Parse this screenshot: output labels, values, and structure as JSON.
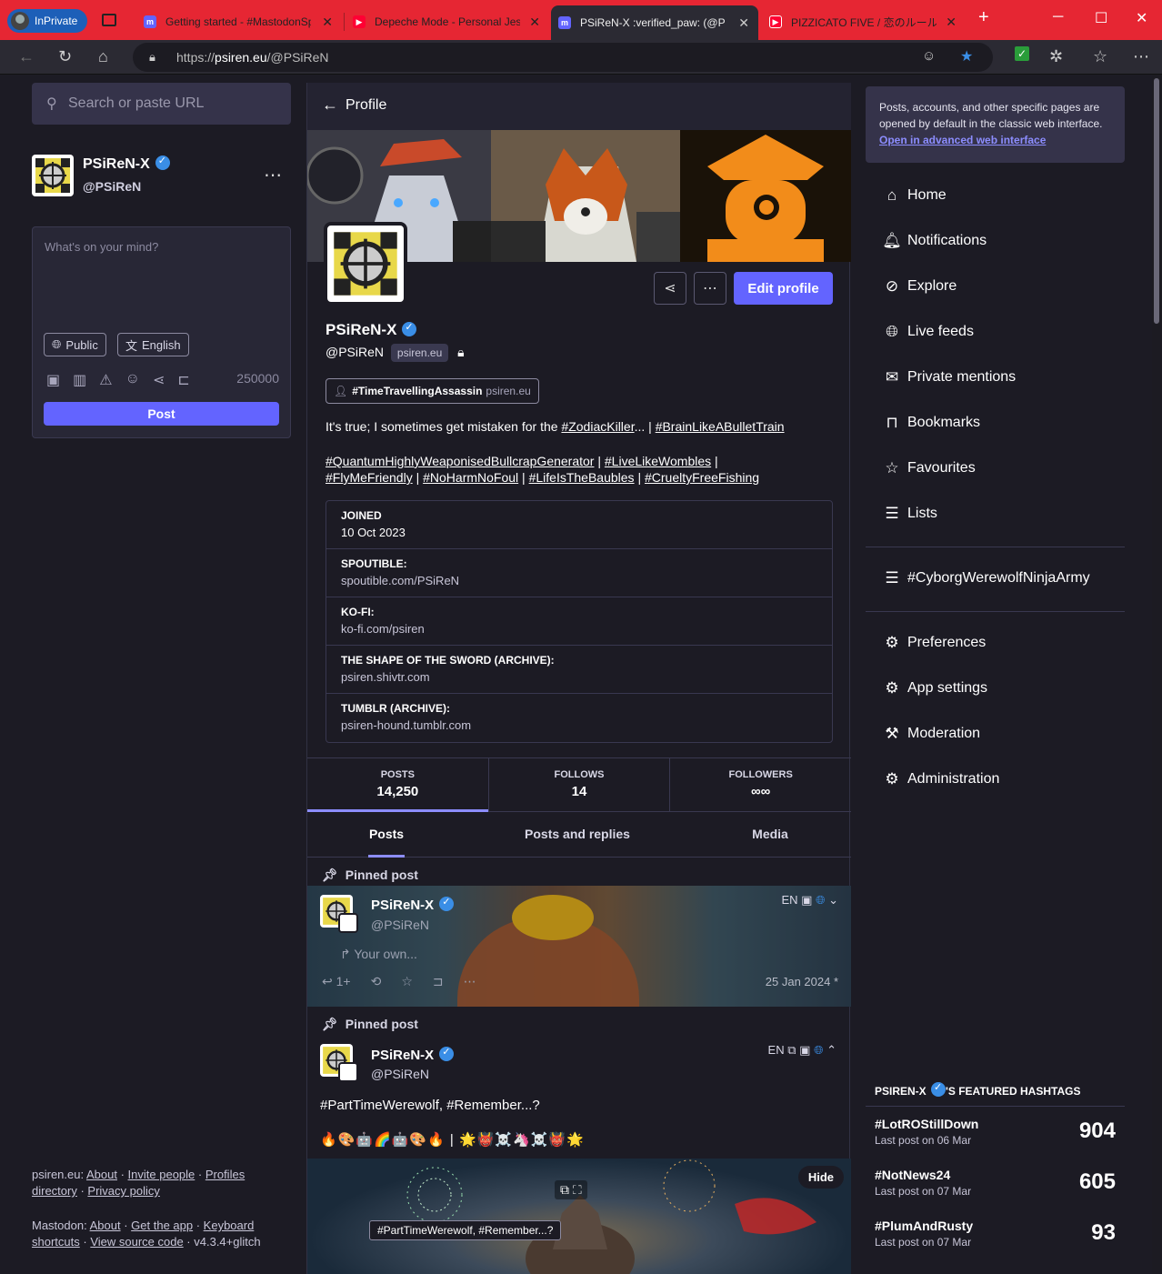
{
  "browser": {
    "inprivate_label": "InPrivate",
    "tabs": [
      {
        "title": "Getting started - #MastodonSp…"
      },
      {
        "title": "Depeche Mode - Personal Jesus"
      },
      {
        "title": "PSiReN-X :verified_paw: (@PSiReN"
      },
      {
        "title": "PIZZICATO FIVE / 恋のルール·新…"
      }
    ],
    "new_tab": "+",
    "url_host": "psiren.eu",
    "url_prefix": "https://",
    "url_path": "/@PSiReN"
  },
  "left": {
    "search_placeholder": "Search or paste URL",
    "account_name": "PSiReN-X",
    "account_handle": "@PSiReN",
    "compose_placeholder": "What's on your mind?",
    "visibility": "Public",
    "language": "English",
    "char_count": "250000",
    "post_label": "Post",
    "footer": {
      "site_label": "psiren.eu",
      "about": "About",
      "invite": "Invite people",
      "profiles": "Profiles directory",
      "privacy": "Privacy policy",
      "mastodon_label": "Mastodon",
      "about2": "About",
      "get_app": "Get the app",
      "keyboard": "Keyboard shortcuts",
      "source": "View source code",
      "version": "v4.3.4+glitch"
    }
  },
  "profile": {
    "header_title": "Profile",
    "display_name": "PSiReN-X",
    "handle": "@PSiReN",
    "domain": "psiren.eu",
    "edit_label": "Edit profile",
    "featured_tag": "#TimeTravellingAssassin",
    "featured_tag_domain": "psiren.eu",
    "bio_line1_text": "It's true; I sometimes get mistaken for the ",
    "bio_line1_link1": "#ZodiacKiller",
    "bio_line1_mid": "... | ",
    "bio_line1_link2": "#BrainLikeABulletTrain",
    "bio_line2": [
      {
        "tag": "#QuantumHighlyWeaponisedBullcrapGenerator",
        "sep": " | "
      },
      {
        "tag": "#LiveLikeWombles",
        "sep": " |"
      }
    ],
    "bio_line3": [
      {
        "tag": "#FlyMeFriendly",
        "sep": " | "
      },
      {
        "tag": "#NoHarmNoFoul",
        "sep": " | "
      },
      {
        "tag": "#LifeIsTheBaubles",
        "sep": " | "
      },
      {
        "tag": "#CrueltyFreeFishing",
        "sep": ""
      }
    ],
    "fields": [
      {
        "key": "JOINED",
        "value": "10 Oct 2023"
      },
      {
        "key": "SPOUTIBLE:",
        "value": "spoutible.com/PSiReN"
      },
      {
        "key": "KO-FI:",
        "value": "ko-fi.com/psiren"
      },
      {
        "key": "THE SHAPE OF THE SWORD (ARCHIVE):",
        "value": "psiren.shivtr.com"
      },
      {
        "key": "TUMBLR (ARCHIVE):",
        "value": "psiren-hound.tumblr.com"
      }
    ],
    "stats": [
      {
        "label": "POSTS",
        "value": "14,250"
      },
      {
        "label": "FOLLOWS",
        "value": "14"
      },
      {
        "label": "FOLLOWERS",
        "value": "∞∞"
      }
    ],
    "tabs": [
      "Posts",
      "Posts and replies",
      "Media"
    ]
  },
  "statuses": [
    {
      "pinned_label": "Pinned post",
      "name": "PSiReN-X",
      "handle": "@PSiReN",
      "lang": "EN",
      "preview": "Your own...",
      "timestamp": "25 Jan 2024 *",
      "reply_count": "1+"
    },
    {
      "pinned_label": "Pinned post",
      "name": "PSiReN-X",
      "handle": "@PSiReN",
      "lang": "EN",
      "text": "#PartTimeWerewolf, #Remember...?",
      "emoji_line": "🔥🎨🤖🌈🤖🎨🔥 | 🌟👹☠️🦄☠️👹🌟",
      "hide_label": "Hide",
      "alt_text": "#PartTimeWerewolf, #Remember...?"
    }
  ],
  "right": {
    "notice_text": "Posts, accounts, and other specific pages are opened by default in the classic web interface. ",
    "notice_link": "Open in advanced web interface",
    "nav": [
      {
        "label": "Home",
        "icon": "home-icon"
      },
      {
        "label": "Notifications",
        "icon": "bell-icon"
      },
      {
        "label": "Explore",
        "icon": "compass-icon"
      },
      {
        "label": "Live feeds",
        "icon": "globe-icon"
      },
      {
        "label": "Private mentions",
        "icon": "mail-icon"
      },
      {
        "label": "Bookmarks",
        "icon": "bookmark-icon"
      },
      {
        "label": "Favourites",
        "icon": "star-icon"
      },
      {
        "label": "Lists",
        "icon": "list-icon"
      }
    ],
    "list_item": "#CyborgWerewolfNinjaArmy",
    "settings": [
      {
        "label": "Preferences",
        "icon": "gear-icon"
      },
      {
        "label": "App settings",
        "icon": "gears-icon"
      },
      {
        "label": "Moderation",
        "icon": "gavel-icon"
      },
      {
        "label": "Administration",
        "icon": "gears-icon"
      }
    ],
    "featured_header_name": "PSIREN-X",
    "featured_header_suffix": "'S FEATURED HASHTAGS",
    "featured": [
      {
        "tag": "#LotROStillDown",
        "sub": "Last post on 06 Mar",
        "count": "904"
      },
      {
        "tag": "#NotNews24",
        "sub": "Last post on 07 Mar",
        "count": "605"
      },
      {
        "tag": "#PlumAndRusty",
        "sub": "Last post on 07 Mar",
        "count": "93"
      }
    ]
  }
}
